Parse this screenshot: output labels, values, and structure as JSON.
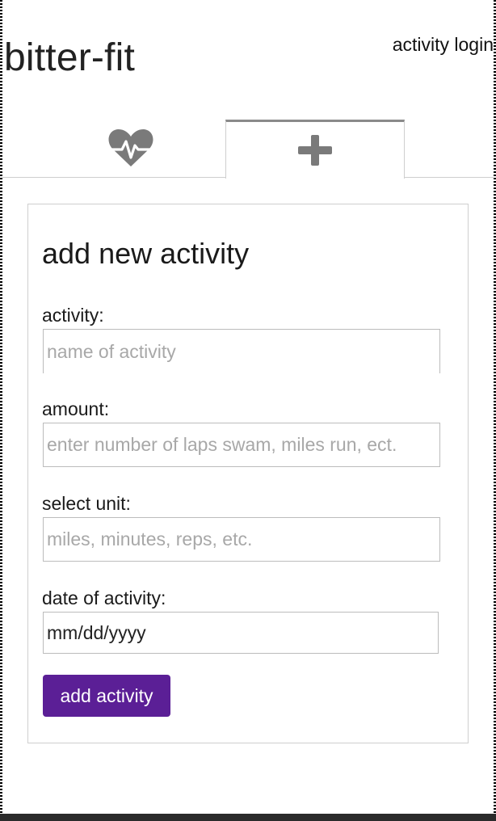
{
  "header": {
    "title": "bitter-fit",
    "login_link": "activity login"
  },
  "tabs": [
    {
      "icon": "heart-pulse-icon",
      "active": false
    },
    {
      "icon": "plus-icon",
      "active": true
    }
  ],
  "form": {
    "heading": "add new activity",
    "activity_label": "activity:",
    "activity_placeholder": "name of activity",
    "amount_label": "amount:",
    "amount_placeholder": "enter number of laps swam, miles run, ect.",
    "unit_label": "select unit:",
    "unit_placeholder": "miles, minutes, reps, etc.",
    "date_label": "date of activity:",
    "date_value": "mm/dd/yyyy",
    "submit_label": "add activity"
  },
  "colors": {
    "accent": "#5b1f96",
    "icon_gray": "#7a7a7a"
  }
}
